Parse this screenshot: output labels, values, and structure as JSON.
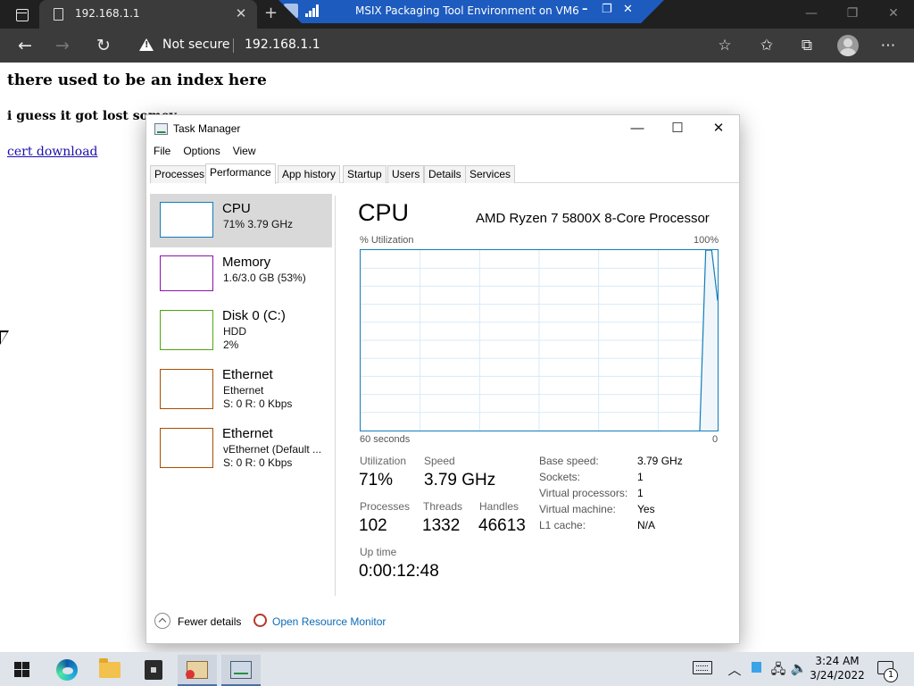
{
  "browser": {
    "tab_title": "192.168.1.1",
    "tab_close": "✕",
    "new_tab": "+",
    "security_label": "Not secure",
    "url": "192.168.1.1"
  },
  "rdp": {
    "title": "MSIX Packaging Tool Environment on VM6",
    "minimize": "–",
    "restore": "❐",
    "close": "✕"
  },
  "page": {
    "heading": "there used to be an index here",
    "subheading": "i guess it got lost somev",
    "link": "cert download"
  },
  "taskmanager": {
    "title": "Task Manager",
    "menu": [
      "File",
      "Options",
      "View"
    ],
    "tabs": [
      "Processes",
      "Performance",
      "App history",
      "Startup",
      "Users",
      "Details",
      "Services"
    ],
    "active_tab": "Performance",
    "resources": [
      {
        "name": "CPU",
        "line1": "71% 3.79 GHz",
        "line2": "",
        "color": "#117dbb",
        "selected": true
      },
      {
        "name": "Memory",
        "line1": "1.6/3.0 GB (53%)",
        "line2": "",
        "color": "#8b12ae"
      },
      {
        "name": "Disk 0 (C:)",
        "line1": "HDD",
        "line2": "2%",
        "color": "#4da60c"
      },
      {
        "name": "Ethernet",
        "line1": "Ethernet",
        "line2": "S: 0 R: 0 Kbps",
        "color": "#a74f01"
      },
      {
        "name": "Ethernet",
        "line1": "vEthernet (Default ...",
        "line2": "S: 0 R: 0 Kbps",
        "color": "#a74f01"
      }
    ],
    "cpu": {
      "heading": "CPU",
      "processor": "AMD Ryzen 7 5800X 8-Core Processor",
      "util_label": "% Utilization",
      "util_max": "100%",
      "time_label": "60 seconds",
      "time_min": "0",
      "stats": {
        "utilization_label": "Utilization",
        "utilization": "71%",
        "speed_label": "Speed",
        "speed": "3.79 GHz",
        "processes_label": "Processes",
        "processes": "102",
        "threads_label": "Threads",
        "threads": "1332",
        "handles_label": "Handles",
        "handles": "46613",
        "uptime_label": "Up time",
        "uptime": "0:00:12:48"
      },
      "details": [
        {
          "label": "Base speed:",
          "value": "3.79 GHz"
        },
        {
          "label": "Sockets:",
          "value": "1"
        },
        {
          "label": "Virtual processors:",
          "value": "1"
        },
        {
          "label": "Virtual machine:",
          "value": "Yes"
        },
        {
          "label": "L1 cache:",
          "value": "N/A"
        }
      ],
      "history_percent": [
        0,
        100,
        100,
        72
      ]
    },
    "footer": {
      "fewer_details": "Fewer details",
      "resource_monitor": "Open Resource Monitor"
    }
  },
  "taskbar": {
    "time": "3:24 AM",
    "date": "3/24/2022",
    "notification_count": "1"
  }
}
